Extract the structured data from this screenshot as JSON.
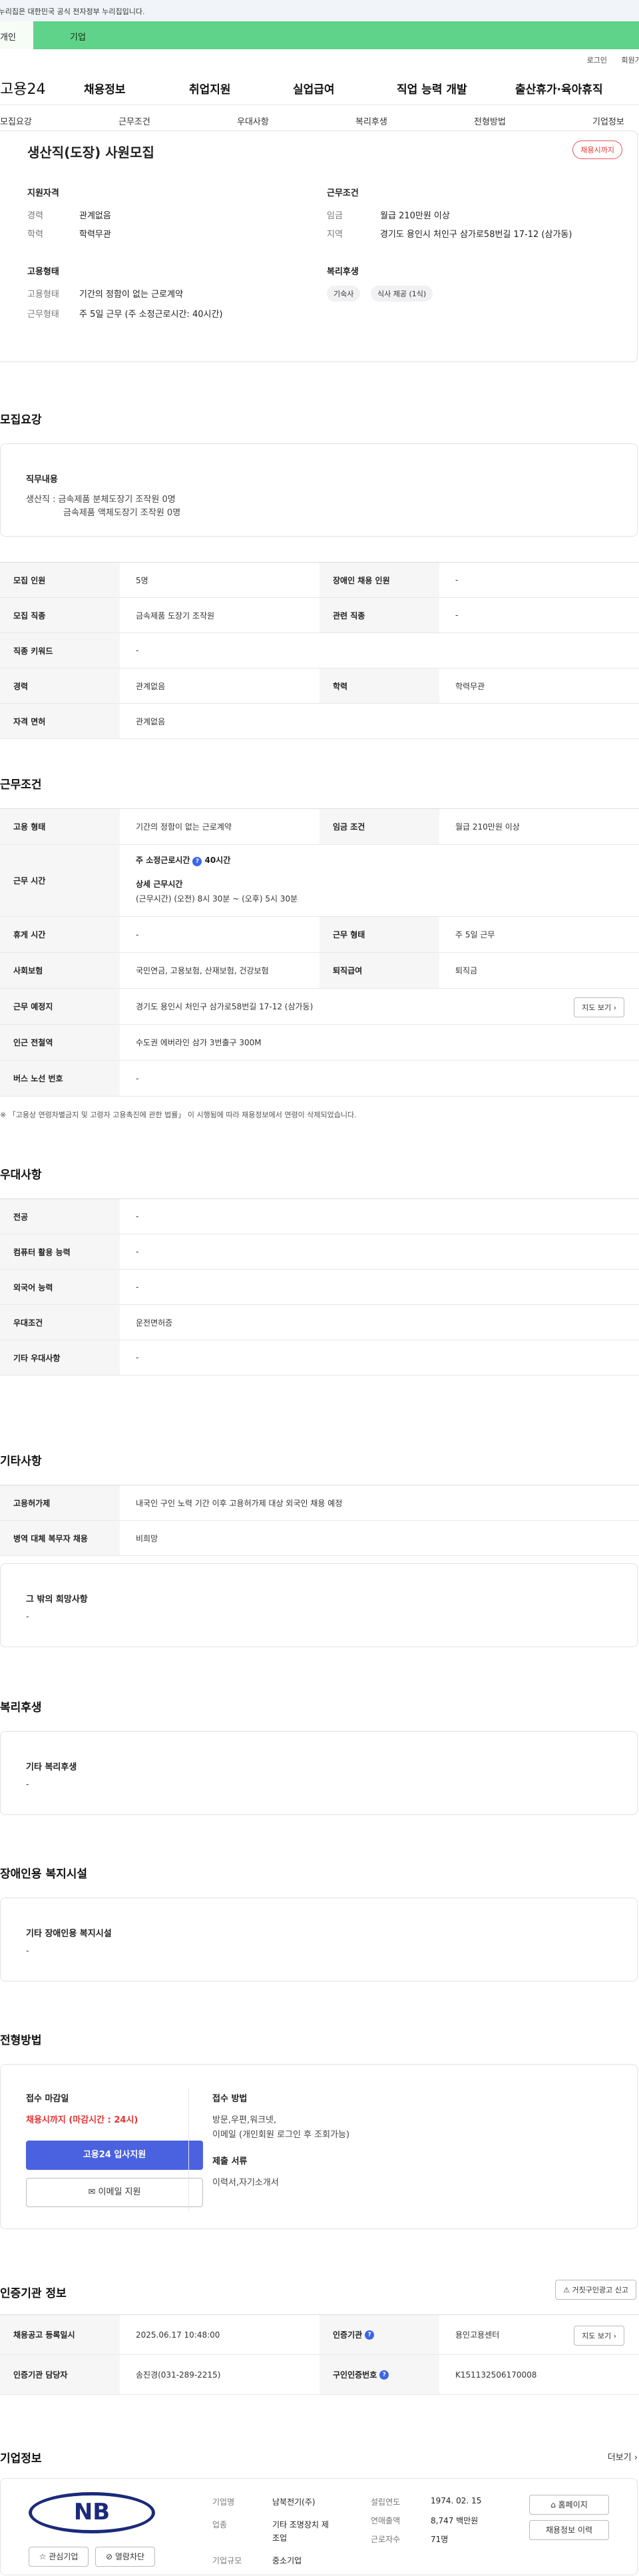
{
  "top": {
    "gov_notice": "이 누리집은 대한민국 공식 전자정부 누리집입니다.",
    "tab_personal": "개인",
    "tab_corp": "기업",
    "login": "로그인",
    "join": "회원가입"
  },
  "gnb": {
    "logo": "고용24",
    "items": [
      "채용정보",
      "취업지원",
      "실업급여",
      "직업 능력 개발",
      "출산휴가·육아휴직"
    ]
  },
  "subnav": [
    "모집요강",
    "근무조건",
    "우대사항",
    "복리후생",
    "전형방법",
    "기업정보"
  ],
  "summary": {
    "title": "생산직(도장) 사원모집",
    "badge": "채용시까지",
    "sec_qual": "지원자격",
    "career_label": "경력",
    "career_value": "관계없음",
    "edu_label": "학력",
    "edu_value": "학력무관",
    "sec_cond": "근무조건",
    "wage_label": "임금",
    "wage_value": "월급 210만원 이상",
    "loc_label": "지역",
    "loc_value": "경기도 용인시 처인구 삼가로58번길 17-12 (삼가동)",
    "sec_emp": "고용형태",
    "emp_type_label": "고용형태",
    "emp_type_value": "기간의 정함이 없는 근로계약",
    "work_type_label": "근무형태",
    "work_type_value": "주 5일 근무 (주 소정근로시간: 40시간)",
    "sec_welfare": "복리후생",
    "chips": [
      "기숙사",
      "식사 제공 (1식)"
    ]
  },
  "recruit": {
    "heading": "모집요강",
    "duty_title": "직무내용",
    "duty_line1": "생산직 : 금속제품 분체도장기 조작원 0명",
    "duty_line2": "금속제품 액체도장기 조작원 0명",
    "rows": [
      {
        "l1": "모집 인원",
        "v1": "5명",
        "l2": "장애인 채용 인원",
        "v2": "-"
      },
      {
        "l1": "모집 직종",
        "v1": "금속제품 도장기 조작원",
        "l2": "관련 직종",
        "v2": "-"
      },
      {
        "l1": "직종 키워드",
        "v1": "-"
      },
      {
        "l1": "경력",
        "v1": "관계없음",
        "l2": "학력",
        "v2": "학력무관"
      },
      {
        "l1": "자격 면허",
        "v1": "관계없음"
      }
    ]
  },
  "work": {
    "heading": "근무조건",
    "emp_type_label": "고용 형태",
    "emp_type_value": "기간의 정함이 없는 근로계약",
    "wage_label": "임금 조건",
    "wage_value": "월급 210만원 이상",
    "hours_label": "근무 시간",
    "weekly_title": "주 소정근로시간",
    "weekly_value": "40시간",
    "detail_title": "상세 근무시간",
    "detail_value": "(근무시간) (오전) 8시 30분 ~ (오후) 5시 30분",
    "rest_label": "휴게 시간",
    "rest_value": "-",
    "work_form_label": "근무 형태",
    "work_form_value": "주 5일 근무",
    "insurance_label": "사회보험",
    "insurance_value": "국민연금, 고용보험, 산재보험, 건강보험",
    "retire_label": "퇴직급여",
    "retire_value": "퇴직금",
    "place_label": "근무 예정지",
    "place_value": "경기도 용인시 처인구 삼가로58번길 17-12 (삼가동)",
    "map_btn": "지도 보기",
    "subway_label": "인근 전철역",
    "subway_value": "수도권 에버라인 삼가 3번출구 300M",
    "bus_label": "버스 노선 번호",
    "bus_value": "-",
    "note": "※ 「고용상 연령차별금지 및 고령자 고용촉진에 관한 법률」 이 시행됨에 따라 채용정보에서 연령이 삭제되었습니다."
  },
  "pref": {
    "heading": "우대사항",
    "rows": [
      {
        "l": "전공",
        "v": "-"
      },
      {
        "l": "컴퓨터 활용 능력",
        "v": "-"
      },
      {
        "l": "외국어 능력",
        "v": "-"
      },
      {
        "l": "우대조건",
        "v": "운전면허증"
      },
      {
        "l": "기타 우대사항",
        "v": "-"
      }
    ]
  },
  "etc": {
    "heading": "기타사항",
    "rows": [
      {
        "l": "고용허가제",
        "v": "내국인 구인 노력 기간 이후 고용허가제 대상 외국인 채용 예정"
      },
      {
        "l": "병역 대체 복무자 채용",
        "v": "비희망"
      }
    ],
    "box_title": "그 밖의 희망사항",
    "box_value": "-"
  },
  "welfare": {
    "heading": "복리후생",
    "box_title": "기타 복리후생",
    "box_value": "-"
  },
  "disabled": {
    "heading": "장애인용 복지시설",
    "box_title": "기타 장애인용 복지시설",
    "box_value": "-"
  },
  "selection": {
    "heading": "전형방법",
    "deadline_title": "접수 마감일",
    "deadline_value": "채용시까지 (마감시간 : 24시)",
    "apply_btn": "고용24 입사지원",
    "email_btn": "이메일 지원",
    "method_title": "접수 방법",
    "method_value1": "방문,우편,워크넷,",
    "method_value2": "이메일 (개인회원 로그인 후 조회가능)",
    "docs_title": "제출 서류",
    "docs_value": "이력서,자기소개서"
  },
  "agency": {
    "heading": "인증기관 정보",
    "report_btn": "거짓구인광고 신고",
    "reg_label": "채용공고 등록일시",
    "reg_value": "2025.06.17 10:48:00",
    "org_label": "인증기관",
    "org_value": "용인고용센터",
    "map_btn": "지도 보기",
    "manager_label": "인증기관 담당자",
    "manager_value": "송진경(031-289-2215)",
    "job_no_label": "구인인증번호",
    "job_no_value": "K151132506170008"
  },
  "company": {
    "heading": "기업정보",
    "more": "더보기",
    "logo_text": "NB",
    "fav_btn": "관심기업",
    "block_btn": "열람차단",
    "name_label": "기업명",
    "name_value": "남북전기(주)",
    "biz_label": "업종",
    "biz_value1": "기타 조명장치 제",
    "biz_value2": "조업",
    "size_label": "기업규모",
    "size_value": "중소기업",
    "founded_label": "설립연도",
    "founded_value": "1974. 02. 15",
    "sales_label": "연매출액",
    "sales_value": "8,747 백만원",
    "emp_label": "근로자수",
    "emp_value": "71명",
    "homepage_btn": "홈페이지",
    "history_btn": "채용정보 이력"
  },
  "colors": {
    "brand_green": "#5fd38a",
    "accent_blue": "#4a62e0",
    "alert_red": "#e33333"
  }
}
